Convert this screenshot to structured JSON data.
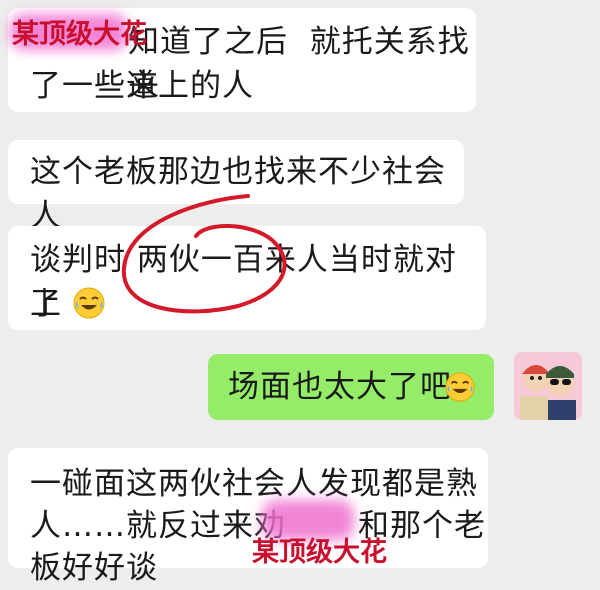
{
  "messages": [
    {
      "id": "m1",
      "side": "left",
      "lines": [
        "知道了之后  就托关系找来",
        "了一些道上的人"
      ]
    },
    {
      "id": "m2",
      "side": "left",
      "lines": [
        "这个老板那边也找来不少社会人"
      ]
    },
    {
      "id": "m3",
      "side": "left",
      "lines": [
        "谈判时 两伙一百来人当时就对上",
        "了"
      ],
      "trailing_icon": "laughing-crying-emoji"
    },
    {
      "id": "m4",
      "side": "right",
      "lines": [
        "场面也太大了吧"
      ],
      "trailing_icon": "laughing-crying-emoji"
    },
    {
      "id": "m5",
      "side": "left",
      "lines": [
        "一碰面这两伙社会人发现都是熟",
        "人……就反过来劝",
        "和那个老",
        "板好好谈"
      ]
    }
  ],
  "watermarks": {
    "top": "某顶级大花",
    "bottom": "某顶级大花"
  },
  "colors": {
    "background": "#ededed",
    "incoming_bubble": "#ffffff",
    "outgoing_bubble": "#95ec69",
    "annotation_red": "#d41a2a",
    "watermark_red": "#c8102e",
    "blur_pink": "#f06fd0"
  },
  "icons": {
    "avatar": "cartoon-avatar-icon",
    "emoji": "laughing-crying-emoji"
  }
}
